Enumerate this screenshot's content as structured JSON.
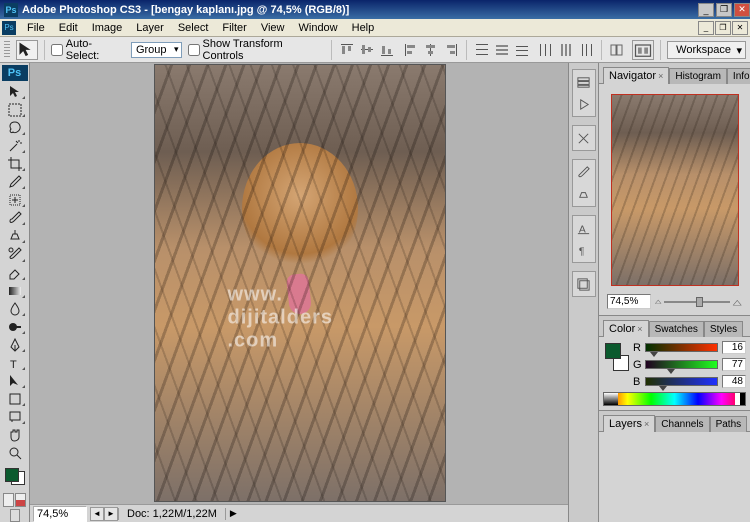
{
  "titlebar": {
    "ps_abbr": "Ps",
    "title": "Adobe Photoshop CS3 - [bengay kaplanı.jpg @ 74,5% (RGB/8)]"
  },
  "menubar": {
    "items": [
      "File",
      "Edit",
      "Image",
      "Layer",
      "Select",
      "Filter",
      "View",
      "Window",
      "Help"
    ]
  },
  "optbar": {
    "auto_select_label": "Auto-Select:",
    "auto_select_value": "Group",
    "transform_label": "Show Transform Controls",
    "workspace_label": "Workspace"
  },
  "canvas": {
    "watermark": "www. dijitalders .com"
  },
  "statusbar": {
    "zoom": "74,5%",
    "doc_label": "Doc: 1,22M/1,22M"
  },
  "panels": {
    "navigator": {
      "tabs": [
        "Navigator",
        "Histogram",
        "Info"
      ],
      "zoom": "74,5%"
    },
    "color": {
      "tabs": [
        "Color",
        "Swatches",
        "Styles"
      ],
      "channels": [
        {
          "name": "R",
          "value": "16",
          "tri_pos": "6%"
        },
        {
          "name": "G",
          "value": "77",
          "tri_pos": "30%"
        },
        {
          "name": "B",
          "value": "48",
          "tri_pos": "18%"
        }
      ]
    },
    "layers": {
      "tabs": [
        "Layers",
        "Channels",
        "Paths"
      ]
    }
  }
}
